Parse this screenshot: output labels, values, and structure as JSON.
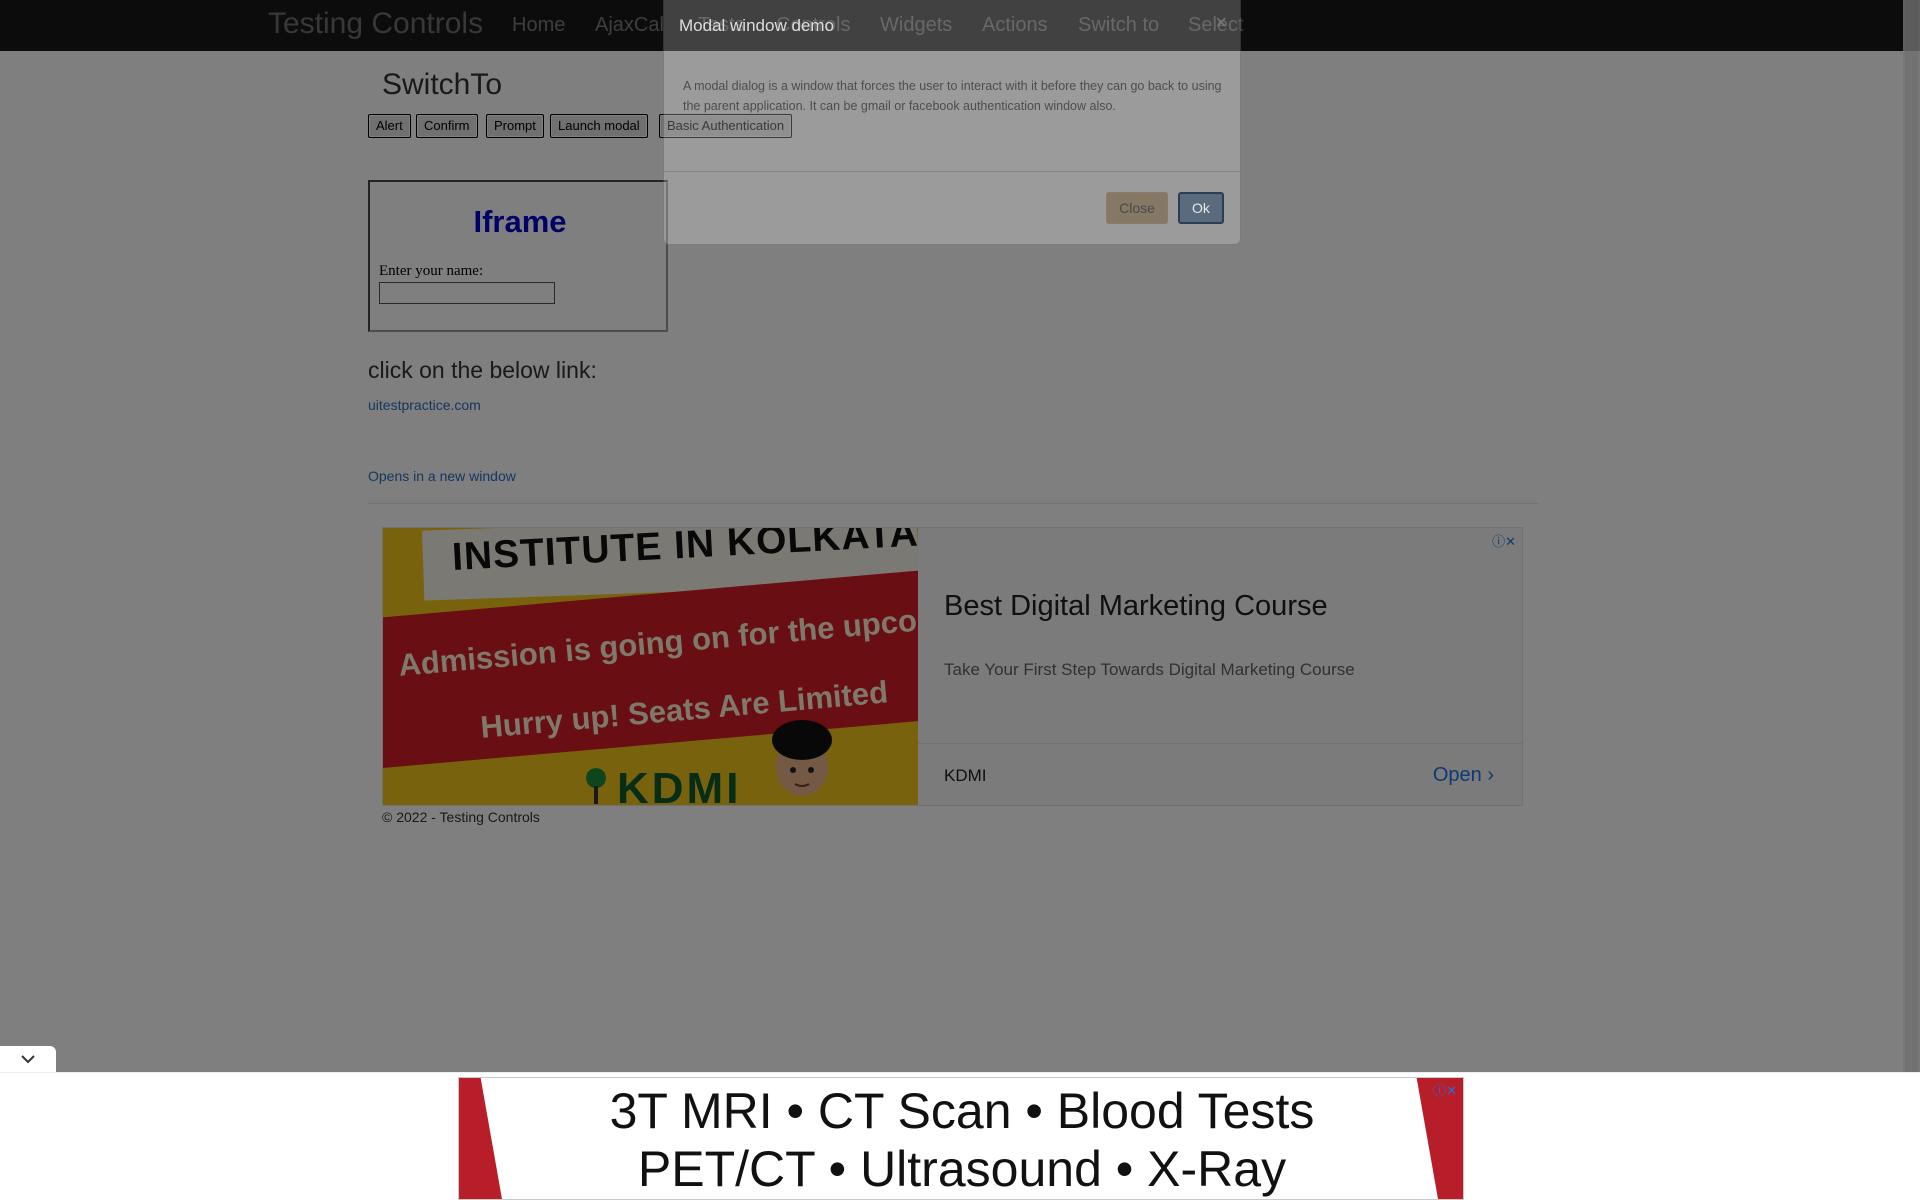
{
  "navbar": {
    "brand": "Testing Controls",
    "items": [
      "Home",
      "AjaxCal",
      "Tests",
      "Controls",
      "Widgets",
      "Actions",
      "Switch to",
      "Select"
    ]
  },
  "page": {
    "title": "SwitchTo",
    "buttons": [
      "Alert",
      "Confirm",
      "Prompt",
      "Launch modal",
      "Basic Authentication"
    ],
    "iframe": {
      "heading": "Iframe",
      "label": "Enter your name:",
      "input_value": ""
    },
    "link_heading": "click on the below link:",
    "link1": "uitestpractice.com",
    "link2": "Opens in a new window",
    "footer": "© 2022 - Testing Controls"
  },
  "ad": {
    "image_text": {
      "line1": "INSTITUTE IN KOLKATA",
      "line2": "Admission is going on for the upcoming batch",
      "line3": "Hurry up! Seats Are Limited",
      "logo": "KDMI"
    },
    "title": "Best Digital Marketing Course",
    "description": "Take Your First Step Towards Digital Marketing Course",
    "advertiser": "KDMI",
    "cta": "Open",
    "choices": "ⓘ✕"
  },
  "modal": {
    "title": "Modal window demo",
    "close_x": "×",
    "body": "A modal dialog is a window that forces the user to interact with it before they can go back to using the parent application. It can be gmail or facebook authentication window also.",
    "close_label": "Close",
    "ok_label": "Ok"
  },
  "anchor_ad": {
    "line1": "3T MRI • CT Scan • Blood Tests",
    "line2": "PET/CT • Ultrasound • X-Ray",
    "choices": "ⓘ✕"
  }
}
